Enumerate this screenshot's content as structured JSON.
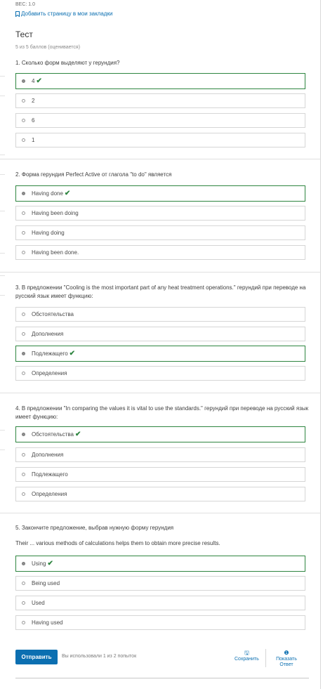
{
  "header": {
    "weight": "ВЕС: 1.0",
    "bookmark": "Добавить страницу в мои закладки",
    "title": "Тест",
    "score": "5 из 5 баллов (оценивается)"
  },
  "questions": [
    {
      "text": "1. Сколько форм выделяют у герундия?",
      "options": [
        "4",
        "2",
        "6",
        "1"
      ],
      "correct_index": 0
    },
    {
      "text": "2. Форма герундия Perfect Active от глагола \"to do\" является",
      "options": [
        "Having done",
        "Having been doing",
        "Having doing",
        "Having been done."
      ],
      "correct_index": 0
    },
    {
      "text": "3. В предложении \"Cooling is the most important part of any heat treatment operations.\" герундий при переводе на русский язык имеет функцию:",
      "options": [
        "Обстоятельства",
        "Дополнения",
        "Подлежащего",
        "Определения"
      ],
      "correct_index": 2
    },
    {
      "text": "4. В предложении \"In comparing the values it is vital to use the standards.\" герундий при переводе на русский язык имеет функцию:",
      "options": [
        "Обстоятельства",
        "Дополнения",
        "Подлежащего",
        "Определения"
      ],
      "correct_index": 0
    },
    {
      "text": "5. Закончите предложение, выбрав нужную форму герундия",
      "subtext": "Their ... various methods of calculations helps them to obtain more precise results.",
      "options": [
        "Using",
        "Being used",
        "Used",
        "Having used"
      ],
      "correct_index": 0
    }
  ],
  "footer": {
    "submit": "Отправить",
    "attempts": "Вы использовали 1 из 2 попыток",
    "save": "Сохранить",
    "show_answer_line1": "Показать",
    "show_answer_line2": "Ответ",
    "save_icon": "save-icon",
    "info_icon": "info-icon"
  },
  "colors": {
    "accent": "#0b6fb1",
    "correct": "#2e8540"
  }
}
